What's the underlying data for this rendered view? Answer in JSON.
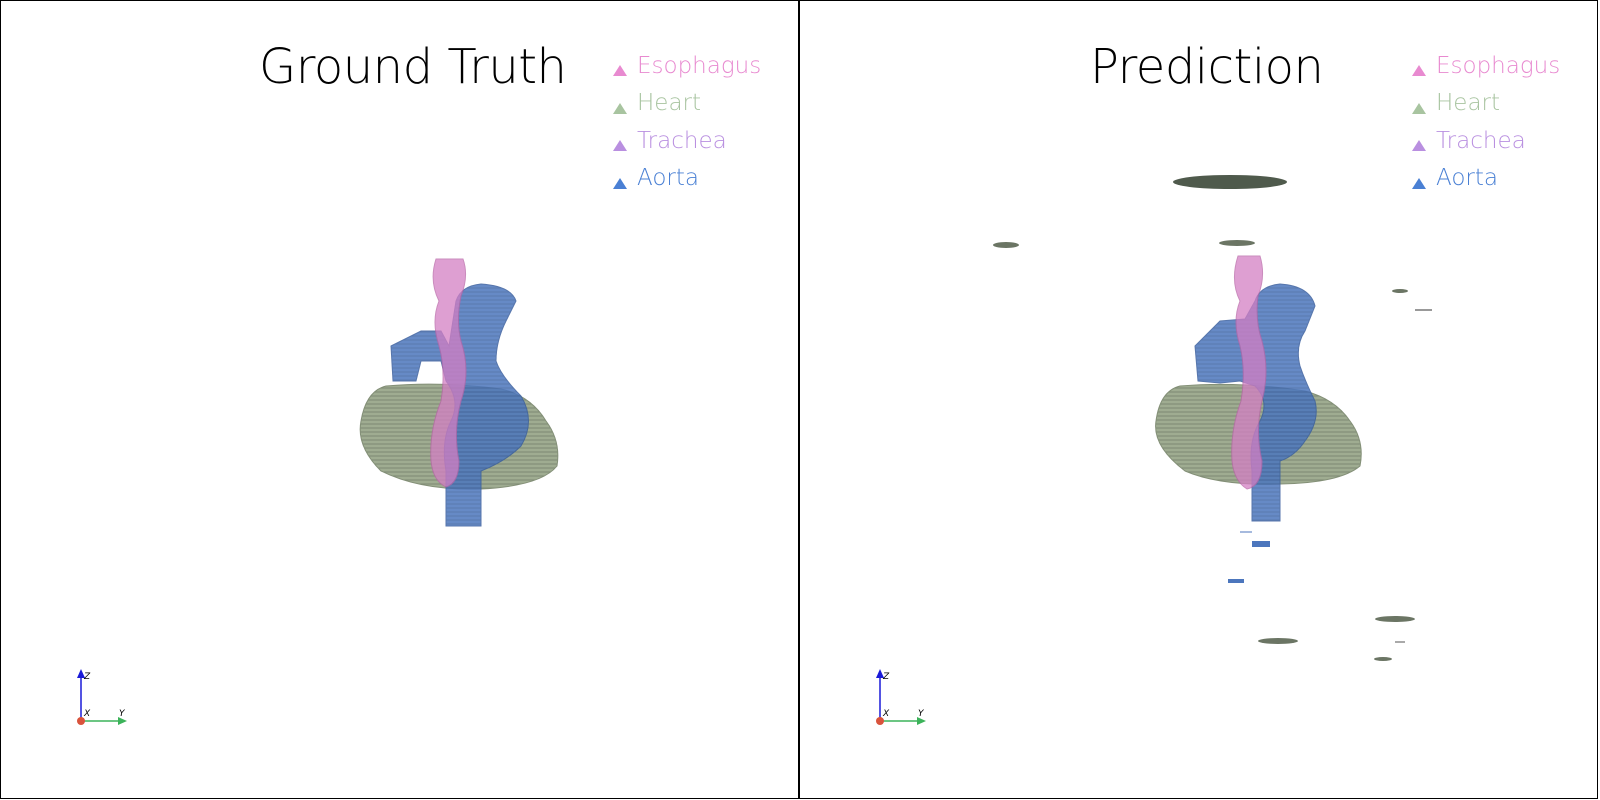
{
  "panels": [
    {
      "title": "Ground Truth",
      "legend": [
        {
          "label": "Esophagus",
          "color": "#e88ad0"
        },
        {
          "label": "Heart",
          "color": "#a8c4a0"
        },
        {
          "label": "Trachea",
          "color": "#b98fe0"
        },
        {
          "label": "Aorta",
          "color": "#4a80d4"
        }
      ],
      "axes": {
        "z": "Z",
        "x": "X",
        "y": "Y"
      }
    },
    {
      "title": "Prediction",
      "legend": [
        {
          "label": "Esophagus",
          "color": "#e88ad0"
        },
        {
          "label": "Heart",
          "color": "#a8c4a0"
        },
        {
          "label": "Trachea",
          "color": "#b98fe0"
        },
        {
          "label": "Aorta",
          "color": "#4a80d4"
        }
      ],
      "axes": {
        "z": "Z",
        "x": "X",
        "y": "Y"
      }
    }
  ],
  "colors": {
    "heart_fill": "#97a68a",
    "aorta_fill": "#4a72b8",
    "esophagus_fill": "#d47fc4",
    "axis_z": "#1a1ad8",
    "axis_y": "#3cb35a",
    "axis_origin": "#d9533c"
  }
}
